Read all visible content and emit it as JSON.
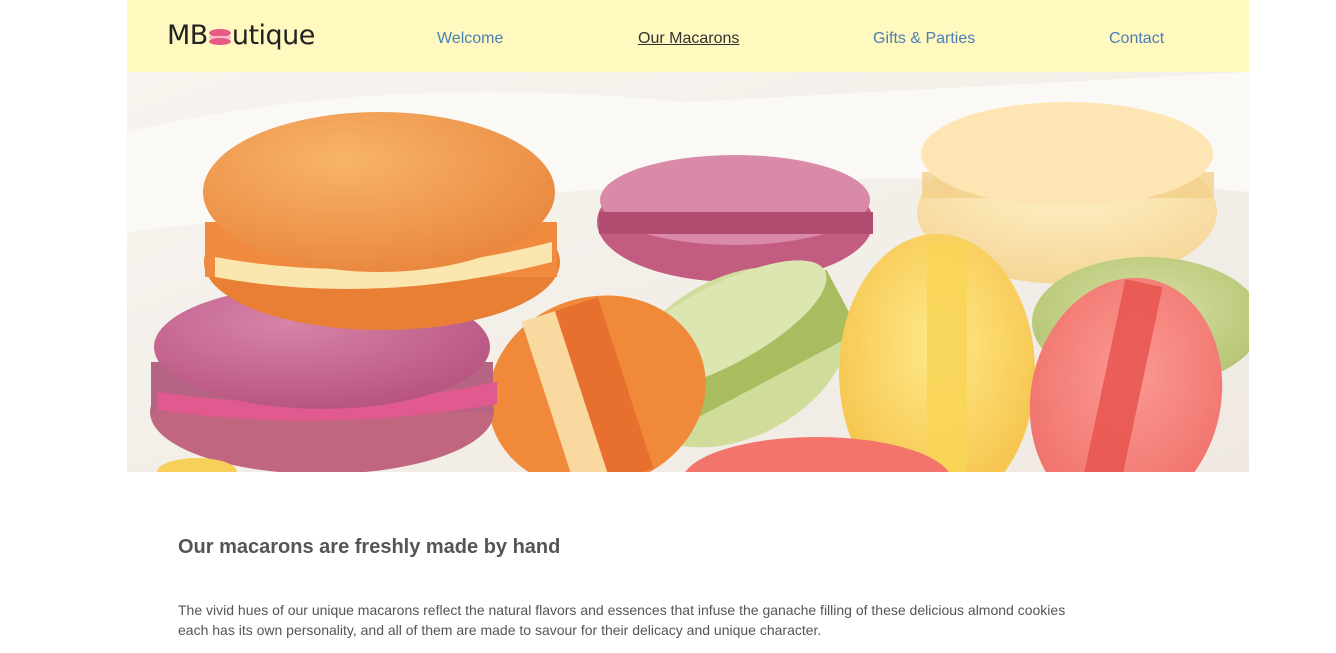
{
  "brand": {
    "logo_prefix": "MB",
    "logo_suffix": "utique",
    "logo_icon": "macaron-icon"
  },
  "nav": {
    "items": [
      {
        "label": "Welcome",
        "active": false
      },
      {
        "label": "Our Macarons",
        "active": true
      },
      {
        "label": "Gifts & Parties",
        "active": false
      },
      {
        "label": "Contact",
        "active": false
      }
    ]
  },
  "hero": {
    "image": "colorful-macarons-photo"
  },
  "content": {
    "heading": "Our macarons are freshly made by hand",
    "paragraph_line1": "The vivid hues of our unique macarons reflect the natural flavors and essences that infuse the ganache filling of these delicious almond cookies",
    "paragraph_line2": "each has its own personality, and all of them are made to savour for their delicacy and unique character."
  },
  "colors": {
    "header_bg": "#fff8bf",
    "nav_link": "#4a7fb5",
    "nav_active": "#333333",
    "text": "#555555",
    "logo_accent": "#e85a86"
  }
}
